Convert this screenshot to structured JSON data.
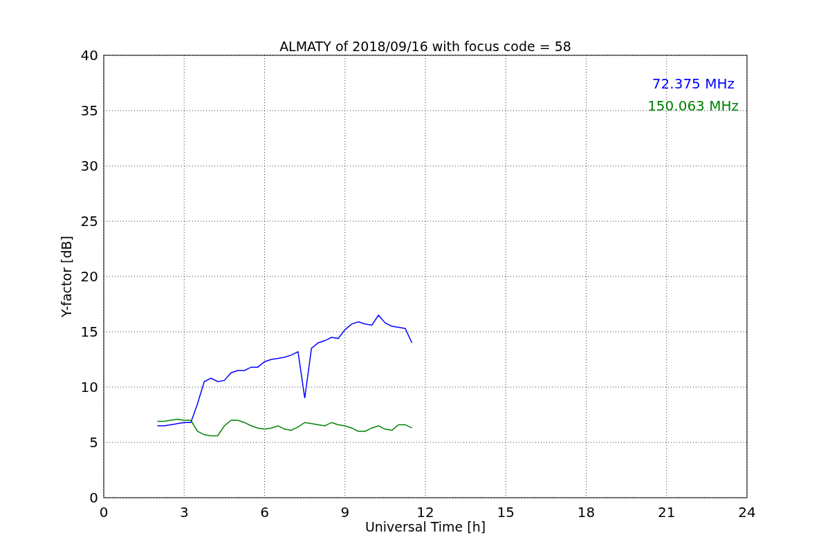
{
  "chart_data": {
    "type": "line",
    "title": "ALMATY of 2018/09/16 with focus code = 58",
    "xlabel": "Universal Time [h]",
    "ylabel": "Y-factor [dB]",
    "x": [
      2,
      2.25,
      2.5,
      2.75,
      3,
      3.25,
      3.5,
      3.75,
      4,
      4.25,
      4.5,
      4.75,
      5,
      5.25,
      5.5,
      5.75,
      6,
      6.25,
      6.5,
      6.75,
      7,
      7.25,
      7.5,
      7.75,
      8,
      8.25,
      8.5,
      8.75,
      9,
      9.25,
      9.5,
      9.75,
      10,
      10.25,
      10.5,
      10.75,
      11,
      11.25,
      11.5
    ],
    "series": [
      {
        "name": "72.375 MHz",
        "color": "#0000ff",
        "values": [
          6.5,
          6.5,
          6.6,
          6.7,
          6.8,
          6.8,
          8.5,
          10.5,
          10.8,
          10.5,
          10.6,
          11.3,
          11.5,
          11.5,
          11.8,
          11.8,
          12.3,
          12.5,
          12.6,
          12.7,
          12.9,
          13.2,
          9,
          13.5,
          14,
          14.2,
          14.5,
          14.4,
          15.2,
          15.7,
          15.9,
          15.7,
          15.6,
          16.5,
          15.8,
          15.5,
          15.4,
          15.3,
          14
        ]
      },
      {
        "name": "150.063 MHz",
        "color": "#008000",
        "values": [
          6.9,
          6.9,
          7,
          7.1,
          7,
          7,
          6,
          5.7,
          5.6,
          5.6,
          6.5,
          7,
          7,
          6.8,
          6.5,
          6.3,
          6.2,
          6.3,
          6.5,
          6.2,
          6.1,
          6.4,
          6.8,
          6.7,
          6.6,
          6.5,
          6.8,
          6.6,
          6.5,
          6.3,
          6,
          6,
          6.3,
          6.5,
          6.2,
          6.1,
          6.6,
          6.6,
          6.3
        ]
      }
    ],
    "grid": true,
    "xlim": [
      0,
      24
    ],
    "ylim": [
      0,
      40
    ],
    "xticks": [
      0,
      3,
      6,
      9,
      12,
      15,
      18,
      21,
      24
    ],
    "yticks": [
      0,
      5,
      10,
      15,
      20,
      25,
      30,
      35,
      40
    ]
  }
}
